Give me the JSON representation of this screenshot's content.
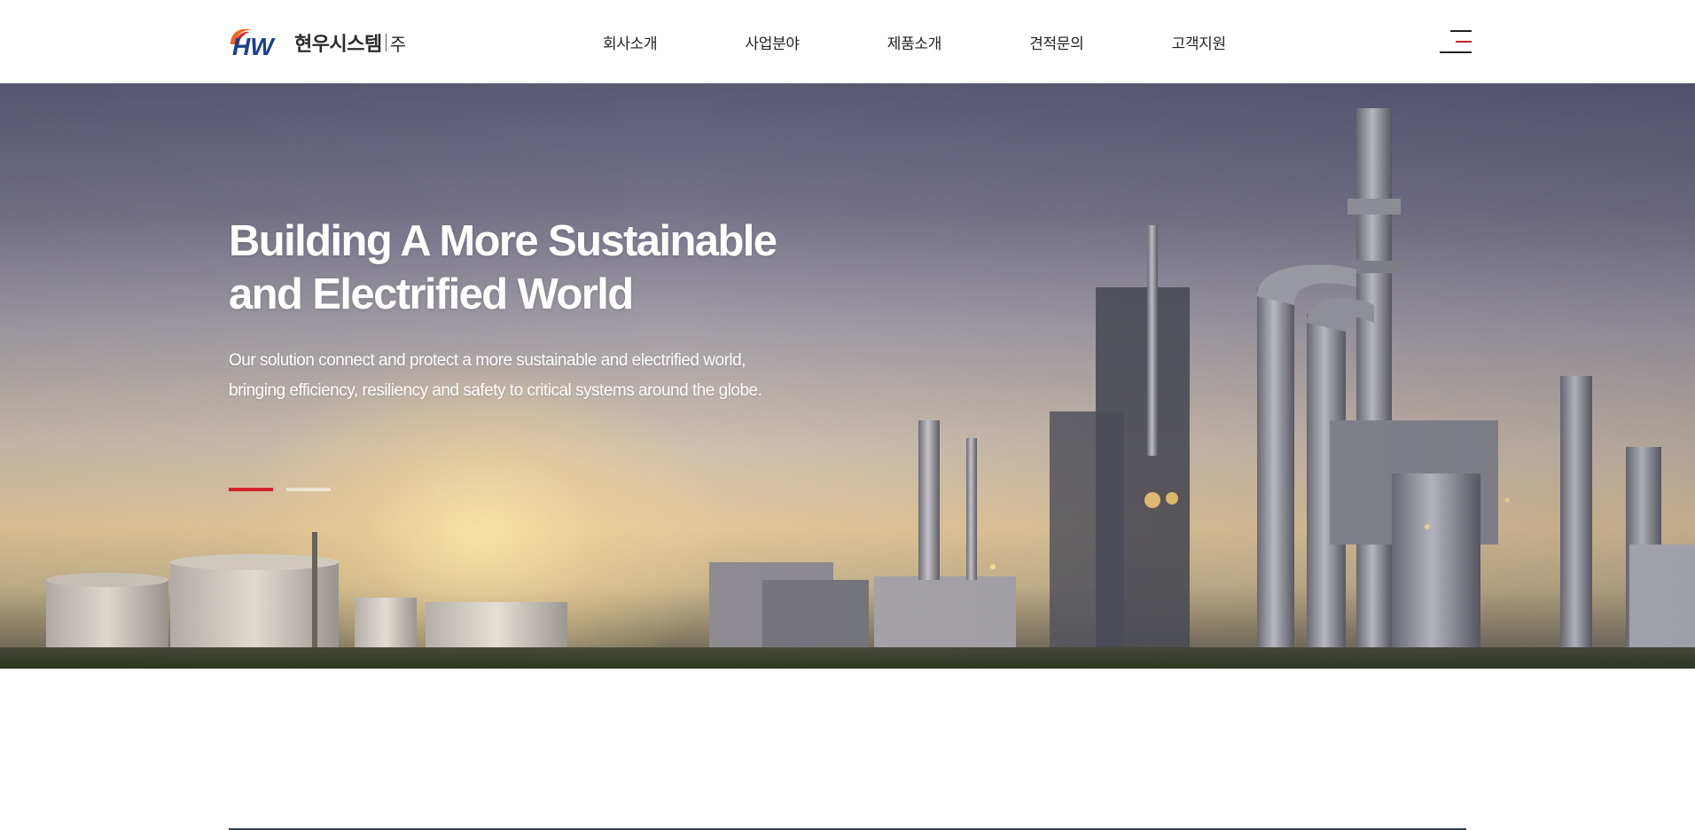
{
  "header": {
    "logo": {
      "mark": "HW",
      "name": "현우시스템",
      "suffix": "주",
      "colors": {
        "blue": "#1d3f8f",
        "orange": "#f0661e",
        "red": "#d3222a"
      }
    },
    "nav": [
      {
        "label": "회사소개"
      },
      {
        "label": "사업분야"
      },
      {
        "label": "제품소개"
      },
      {
        "label": "견적문의"
      },
      {
        "label": "고객지원"
      }
    ],
    "menu_icon": "hamburger-menu-icon"
  },
  "hero": {
    "title_lines": [
      "Building A More Sustainable",
      "and Electrified World"
    ],
    "description_lines": [
      "Our solution connect and protect a more sustainable and electrified world,",
      "bringing efficiency, resiliency and safety to critical systems around the globe."
    ],
    "slides_total": 2,
    "active_slide": 1,
    "accent_color": "#d3222a",
    "background": "industrial-refinery-sunset-image"
  }
}
